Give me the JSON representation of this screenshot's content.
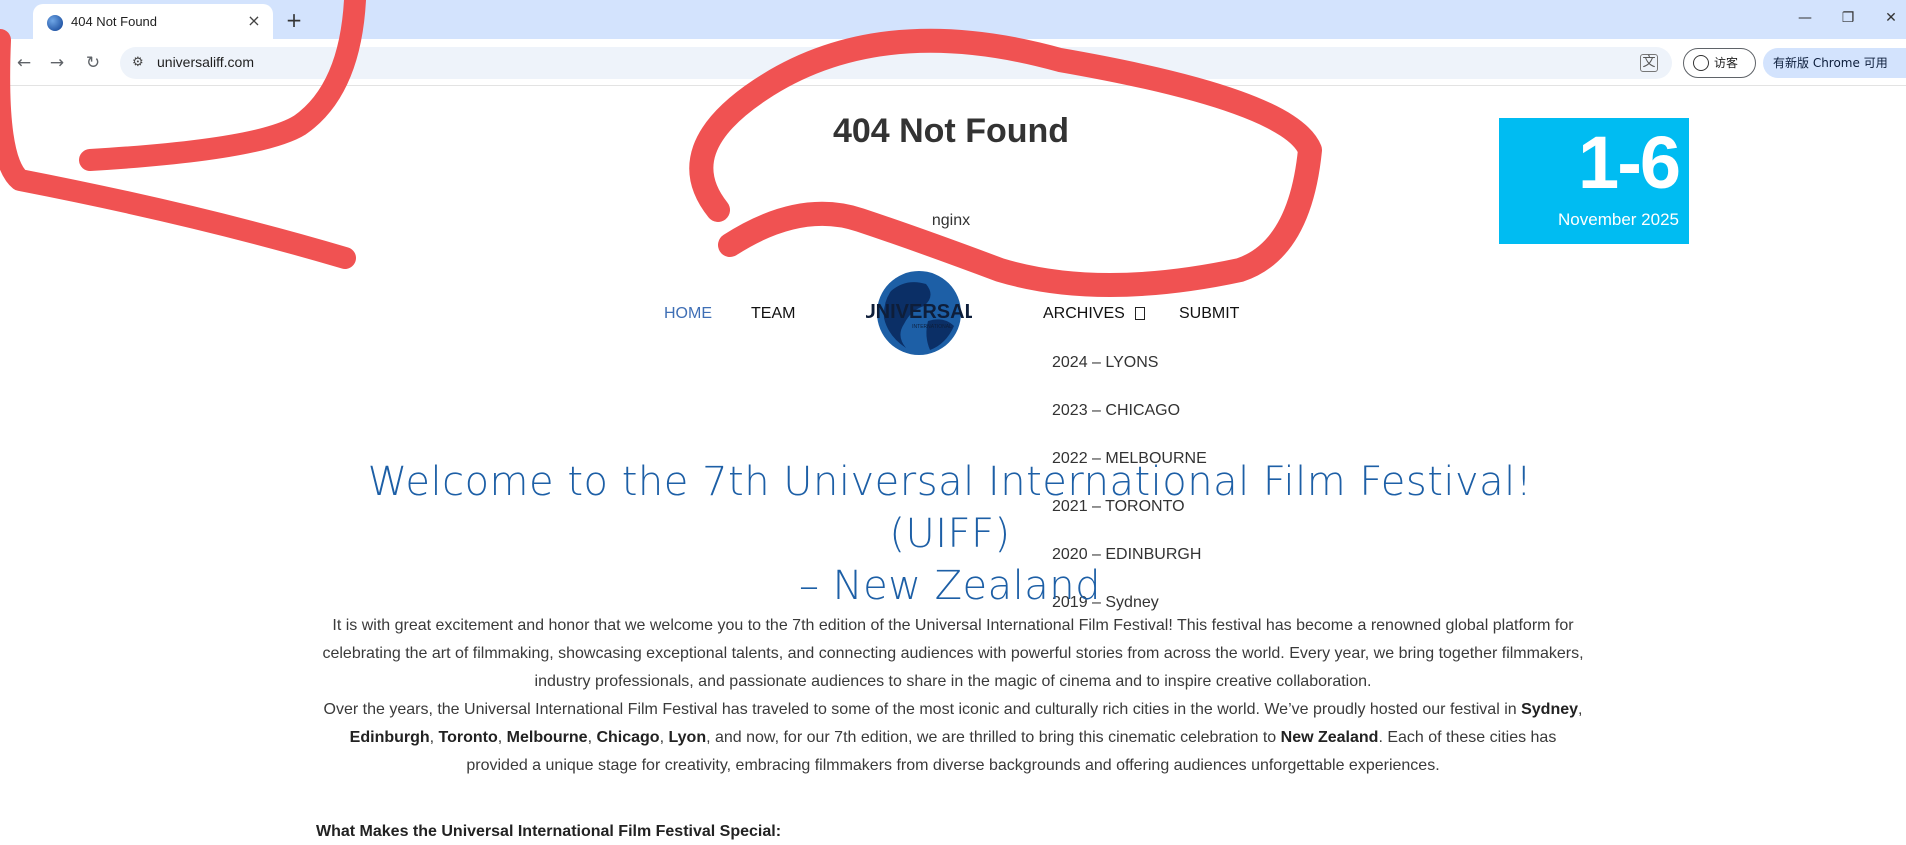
{
  "browser": {
    "tab_title": "404 Not Found",
    "new_tab_label": "+",
    "url": "universaliff.com",
    "profile_label": "访客",
    "update_label": "有新版 Chrome 可用"
  },
  "error": {
    "title": "404 Not Found",
    "server": "nginx"
  },
  "date_badge": {
    "days": "1-6",
    "month": "November 2025"
  },
  "nav": {
    "home": "HOME",
    "team": "TEAM",
    "archives": "ARCHIVES",
    "submit": "SUBMIT",
    "logo_text": "UNIVERSAL",
    "logo_sub": "INTERNATIONAL"
  },
  "archives_menu": [
    "2024 – LYONS",
    "2023 – CHICAGO",
    "2022 – MELBOURNE",
    "2021 – TORONTO",
    "2020 – EDINBURGH",
    "2019 – Sydney"
  ],
  "welcome": {
    "line1": "Welcome to the 7th Universal International Film Festival! (UIFF)",
    "line2": "– New Zealand"
  },
  "intro": {
    "p1": "It is with great excitement and honor that we welcome you to the 7th edition of the Universal International Film Festival! This festival has become a renowned global platform for celebrating the art of filmmaking, showcasing exceptional talents, and connecting audiences with powerful stories from across the world. Every year, we bring together filmmakers, industry professionals, and passionate audiences to share in the magic of cinema and to inspire creative collaboration.",
    "p2_start": "Over the years, the Universal International Film Festival has traveled to some of the most iconic and culturally rich cities in the world. We’ve proudly hosted our festival in ",
    "city1": "Sydney",
    "city2": "Edinburgh",
    "city3": "Toronto",
    "city4": "Melbourne",
    "city5": "Chicago",
    "city6": "Lyon",
    "sep": ", ",
    "p2_mid": ", and now, for our 7th edition, we are thrilled to bring this cinematic celebration to ",
    "country": "New Zealand",
    "p2_end": ". Each of these cities has provided a unique stage for creativity, embracing filmmakers from diverse backgrounds and offering audiences unforgettable experiences."
  },
  "section_heading": "What Makes the Universal International Film Festival Special:",
  "colors": {
    "scribble": "#f05252",
    "accent": "#00bcf2",
    "title_blue": "#1d5fa6"
  }
}
